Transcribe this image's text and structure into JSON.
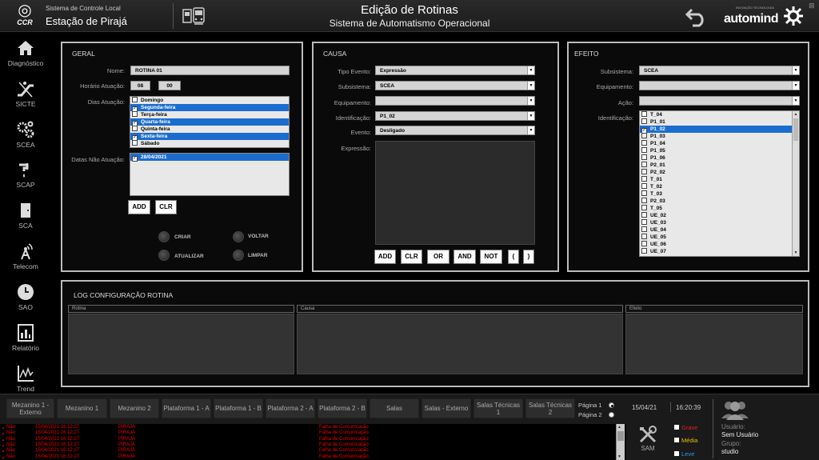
{
  "header": {
    "system_label": "Sistema de Controle Local",
    "station": "Estação de Pirajá",
    "logo_text": "CCR",
    "title": "Edição de Rotinas",
    "subtitle": "Sistema de Automatismo Operacional",
    "brand_small": "INOVAÇÃO TECNOLOGIA",
    "brand": "automind",
    "close_glyph": "⊠"
  },
  "sidebar": {
    "items": [
      {
        "label": "Diagnóstico",
        "icon": "home-icon"
      },
      {
        "label": "SICTE",
        "icon": "escalator-icon"
      },
      {
        "label": "SCEA",
        "icon": "gears-icon"
      },
      {
        "label": "SCAP",
        "icon": "water-icon"
      },
      {
        "label": "SCA",
        "icon": "door-icon"
      },
      {
        "label": "Telecom",
        "icon": "antenna-icon"
      },
      {
        "label": "SAO",
        "icon": "clock-icon"
      },
      {
        "label": "Relatório",
        "icon": "report-icon"
      },
      {
        "label": "Trend",
        "icon": "trend-icon"
      }
    ]
  },
  "geral": {
    "title": "GERAL",
    "nome_label": "Nome:",
    "nome_value": "ROTINA 01",
    "horario_label": "Horário Atuação:",
    "hora": "08",
    "minuto": "00",
    "dias_label": "Dias Atuação:",
    "dias": [
      {
        "name": "Domingo",
        "checked": false
      },
      {
        "name": "Segunda-feira",
        "checked": true
      },
      {
        "name": "Terça-feira",
        "checked": false
      },
      {
        "name": "Quarta-feira",
        "checked": true
      },
      {
        "name": "Quinta-feira",
        "checked": false
      },
      {
        "name": "Sexta-feira",
        "checked": true
      },
      {
        "name": "Sábado",
        "checked": false
      }
    ],
    "datas_label": "Datas Não Atuação:",
    "datas": [
      "28/04/2021"
    ],
    "add_label": "ADD",
    "clr_label": "CLR",
    "criar_label": "CRIAR",
    "voltar_label": "VOLTAR",
    "atualizar_label": "ATUALIZAR",
    "limpar_label": "LIMPAR"
  },
  "causa": {
    "title": "CAUSA",
    "tipo_label": "Tipo Evento:",
    "tipo_value": "Expressão",
    "subsistema_label": "Subsistema:",
    "subsistema_value": "SCEA",
    "equipamento_label": "Equipamento:",
    "equipamento_value": "",
    "identificacao_label": "Identificação:",
    "identificacao_value": "P1_02",
    "evento_label": "Evento:",
    "evento_value": "Desligado",
    "expressao_label": "Expressão:",
    "buttons": [
      "ADD",
      "CLR",
      "OR",
      "AND",
      "NOT",
      "(",
      ")"
    ]
  },
  "efeito": {
    "title": "EFEITO",
    "subsistema_label": "Subsistema:",
    "subsistema_value": "SCEA",
    "equipamento_label": "Equipamento:",
    "equipamento_value": "",
    "acao_label": "Ação:",
    "acao_value": "",
    "identificacao_label": "Identificação:",
    "items": [
      {
        "name": "T_04",
        "checked": false
      },
      {
        "name": "P1_01",
        "checked": false
      },
      {
        "name": "P1_02",
        "checked": true
      },
      {
        "name": "P1_03",
        "checked": false
      },
      {
        "name": "P1_04",
        "checked": false
      },
      {
        "name": "P1_05",
        "checked": false
      },
      {
        "name": "P1_06",
        "checked": false
      },
      {
        "name": "P2_01",
        "checked": false
      },
      {
        "name": "P2_02",
        "checked": false
      },
      {
        "name": "T_01",
        "checked": false
      },
      {
        "name": "T_02",
        "checked": false
      },
      {
        "name": "T_03",
        "checked": false
      },
      {
        "name": "P2_03",
        "checked": false
      },
      {
        "name": "T_05",
        "checked": false
      },
      {
        "name": "UE_02",
        "checked": false
      },
      {
        "name": "UE_03",
        "checked": false
      },
      {
        "name": "UE_04",
        "checked": false
      },
      {
        "name": "UE_05",
        "checked": false
      },
      {
        "name": "UE_06",
        "checked": false
      },
      {
        "name": "UE_07",
        "checked": false
      }
    ]
  },
  "log": {
    "title": "LOG CONFIGURAÇÃO ROTINA",
    "col_rotina": "Rotina",
    "col_causa": "Causa",
    "col_efeito": "Efeito"
  },
  "nav": {
    "buttons": [
      "Mezanino 1 - Externo",
      "Mezanino 1",
      "Mezanino 2",
      "Plataforma 1 - A",
      "Plataforma 1 - B",
      "Plataforma 2 - A",
      "Plataforma 2 - B",
      "Salas",
      "Salas - Externo",
      "Salas Técnicas 1",
      "Salas Técnicas 2"
    ],
    "page1": "Página 1",
    "page2": "Página 2",
    "date": "15/04/21",
    "time": "16:20:39",
    "user_label": "Usuário:",
    "user_value": "Sem Usuário",
    "group_label": "Grupo:",
    "group_value": "studio",
    "sam_label": "SAM",
    "sev_grave": "Grave",
    "sev_media": "Média",
    "sev_leve": "Leve",
    "colors": {
      "grave": "#e02020",
      "media": "#e8c000",
      "leve": "#2a9ae0"
    }
  },
  "alarms": [
    {
      "state": "Não",
      "datetime": "15/04/2021 16:12:27",
      "local": "PIRAJÁ",
      "desc": "Falha de Comunicação"
    },
    {
      "state": "Não",
      "datetime": "15/04/2021 16:12:27",
      "local": "PIRAJÁ",
      "desc": "Falha de Comunicação"
    },
    {
      "state": "Não",
      "datetime": "15/04/2021 16:12:27",
      "local": "PIRAJÁ",
      "desc": "Falha de Comunicação"
    },
    {
      "state": "Não",
      "datetime": "15/04/2021 16:12:27",
      "local": "PIRAJÁ",
      "desc": "Falha de Comunicação"
    },
    {
      "state": "Não",
      "datetime": "15/04/2021 16:12:27",
      "local": "PIRAJÁ",
      "desc": "Falha de Comunicação"
    },
    {
      "state": "Não",
      "datetime": "15/04/2021 16:12:27",
      "local": "PIRAJÁ",
      "desc": "Falha de Comunicação"
    }
  ]
}
